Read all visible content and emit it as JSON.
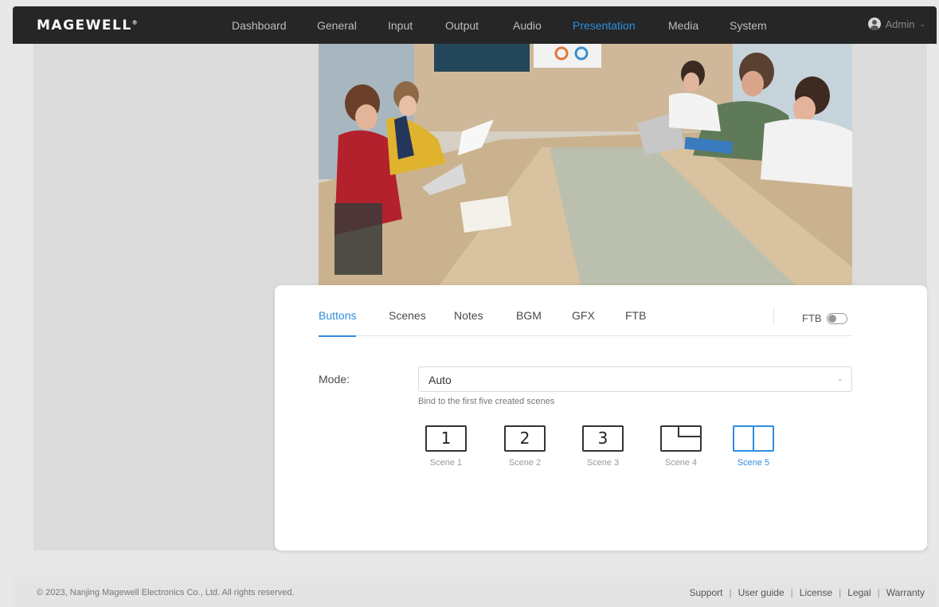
{
  "brand": {
    "logo": "MAGEWELL"
  },
  "nav": {
    "items": [
      "Dashboard",
      "General",
      "Input",
      "Output",
      "Audio",
      "Presentation",
      "Media",
      "System"
    ],
    "active": "Presentation",
    "user": "Admin"
  },
  "panel": {
    "tabs": [
      "Buttons",
      "Scenes",
      "Notes",
      "BGM",
      "GFX",
      "FTB"
    ],
    "active_tab": "Buttons",
    "ftb_toggle_label": "FTB",
    "ftb_toggle_on": false,
    "mode_label": "Mode:",
    "mode_value": "Auto",
    "mode_hint": "Bind to the first five created scenes",
    "scenes": [
      {
        "icon": "1",
        "label": "Scene 1"
      },
      {
        "icon": "2",
        "label": "Scene 2"
      },
      {
        "icon": "3",
        "label": "Scene 3"
      },
      {
        "icon": "",
        "label": "Scene 4"
      },
      {
        "icon": "",
        "label": "Scene 5"
      }
    ],
    "active_scene": "Scene 5"
  },
  "footer": {
    "copyright": "© 2023, Nanjing Magewell Electronics Co., Ltd. All rights reserved.",
    "links": [
      "Support",
      "User guide",
      "License",
      "Legal",
      "Warranty"
    ]
  },
  "colors": {
    "accent": "#2e8ee0",
    "nav_bg": "#262626"
  }
}
